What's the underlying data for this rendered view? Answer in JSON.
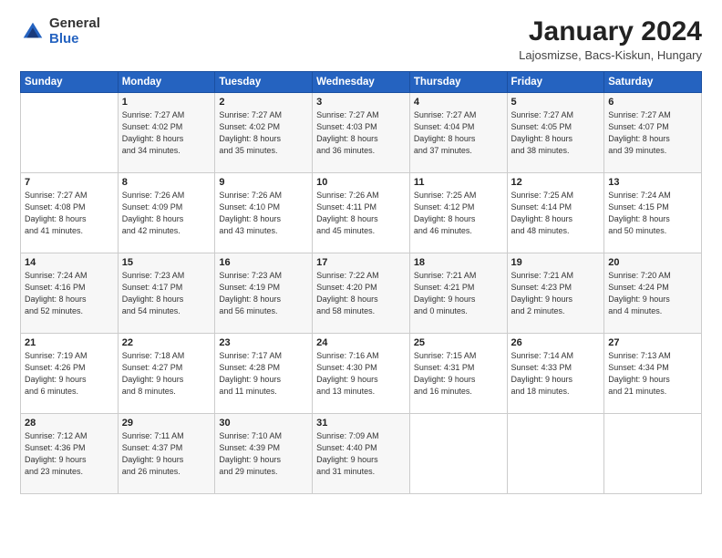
{
  "logo": {
    "general": "General",
    "blue": "Blue"
  },
  "title": {
    "month_year": "January 2024",
    "location": "Lajosmizse, Bacs-Kiskun, Hungary"
  },
  "weekdays": [
    "Sunday",
    "Monday",
    "Tuesday",
    "Wednesday",
    "Thursday",
    "Friday",
    "Saturday"
  ],
  "weeks": [
    [
      {
        "day": "",
        "info": ""
      },
      {
        "day": "1",
        "info": "Sunrise: 7:27 AM\nSunset: 4:02 PM\nDaylight: 8 hours\nand 34 minutes."
      },
      {
        "day": "2",
        "info": "Sunrise: 7:27 AM\nSunset: 4:02 PM\nDaylight: 8 hours\nand 35 minutes."
      },
      {
        "day": "3",
        "info": "Sunrise: 7:27 AM\nSunset: 4:03 PM\nDaylight: 8 hours\nand 36 minutes."
      },
      {
        "day": "4",
        "info": "Sunrise: 7:27 AM\nSunset: 4:04 PM\nDaylight: 8 hours\nand 37 minutes."
      },
      {
        "day": "5",
        "info": "Sunrise: 7:27 AM\nSunset: 4:05 PM\nDaylight: 8 hours\nand 38 minutes."
      },
      {
        "day": "6",
        "info": "Sunrise: 7:27 AM\nSunset: 4:07 PM\nDaylight: 8 hours\nand 39 minutes."
      }
    ],
    [
      {
        "day": "7",
        "info": "Sunrise: 7:27 AM\nSunset: 4:08 PM\nDaylight: 8 hours\nand 41 minutes."
      },
      {
        "day": "8",
        "info": "Sunrise: 7:26 AM\nSunset: 4:09 PM\nDaylight: 8 hours\nand 42 minutes."
      },
      {
        "day": "9",
        "info": "Sunrise: 7:26 AM\nSunset: 4:10 PM\nDaylight: 8 hours\nand 43 minutes."
      },
      {
        "day": "10",
        "info": "Sunrise: 7:26 AM\nSunset: 4:11 PM\nDaylight: 8 hours\nand 45 minutes."
      },
      {
        "day": "11",
        "info": "Sunrise: 7:25 AM\nSunset: 4:12 PM\nDaylight: 8 hours\nand 46 minutes."
      },
      {
        "day": "12",
        "info": "Sunrise: 7:25 AM\nSunset: 4:14 PM\nDaylight: 8 hours\nand 48 minutes."
      },
      {
        "day": "13",
        "info": "Sunrise: 7:24 AM\nSunset: 4:15 PM\nDaylight: 8 hours\nand 50 minutes."
      }
    ],
    [
      {
        "day": "14",
        "info": "Sunrise: 7:24 AM\nSunset: 4:16 PM\nDaylight: 8 hours\nand 52 minutes."
      },
      {
        "day": "15",
        "info": "Sunrise: 7:23 AM\nSunset: 4:17 PM\nDaylight: 8 hours\nand 54 minutes."
      },
      {
        "day": "16",
        "info": "Sunrise: 7:23 AM\nSunset: 4:19 PM\nDaylight: 8 hours\nand 56 minutes."
      },
      {
        "day": "17",
        "info": "Sunrise: 7:22 AM\nSunset: 4:20 PM\nDaylight: 8 hours\nand 58 minutes."
      },
      {
        "day": "18",
        "info": "Sunrise: 7:21 AM\nSunset: 4:21 PM\nDaylight: 9 hours\nand 0 minutes."
      },
      {
        "day": "19",
        "info": "Sunrise: 7:21 AM\nSunset: 4:23 PM\nDaylight: 9 hours\nand 2 minutes."
      },
      {
        "day": "20",
        "info": "Sunrise: 7:20 AM\nSunset: 4:24 PM\nDaylight: 9 hours\nand 4 minutes."
      }
    ],
    [
      {
        "day": "21",
        "info": "Sunrise: 7:19 AM\nSunset: 4:26 PM\nDaylight: 9 hours\nand 6 minutes."
      },
      {
        "day": "22",
        "info": "Sunrise: 7:18 AM\nSunset: 4:27 PM\nDaylight: 9 hours\nand 8 minutes."
      },
      {
        "day": "23",
        "info": "Sunrise: 7:17 AM\nSunset: 4:28 PM\nDaylight: 9 hours\nand 11 minutes."
      },
      {
        "day": "24",
        "info": "Sunrise: 7:16 AM\nSunset: 4:30 PM\nDaylight: 9 hours\nand 13 minutes."
      },
      {
        "day": "25",
        "info": "Sunrise: 7:15 AM\nSunset: 4:31 PM\nDaylight: 9 hours\nand 16 minutes."
      },
      {
        "day": "26",
        "info": "Sunrise: 7:14 AM\nSunset: 4:33 PM\nDaylight: 9 hours\nand 18 minutes."
      },
      {
        "day": "27",
        "info": "Sunrise: 7:13 AM\nSunset: 4:34 PM\nDaylight: 9 hours\nand 21 minutes."
      }
    ],
    [
      {
        "day": "28",
        "info": "Sunrise: 7:12 AM\nSunset: 4:36 PM\nDaylight: 9 hours\nand 23 minutes."
      },
      {
        "day": "29",
        "info": "Sunrise: 7:11 AM\nSunset: 4:37 PM\nDaylight: 9 hours\nand 26 minutes."
      },
      {
        "day": "30",
        "info": "Sunrise: 7:10 AM\nSunset: 4:39 PM\nDaylight: 9 hours\nand 29 minutes."
      },
      {
        "day": "31",
        "info": "Sunrise: 7:09 AM\nSunset: 4:40 PM\nDaylight: 9 hours\nand 31 minutes."
      },
      {
        "day": "",
        "info": ""
      },
      {
        "day": "",
        "info": ""
      },
      {
        "day": "",
        "info": ""
      }
    ]
  ]
}
